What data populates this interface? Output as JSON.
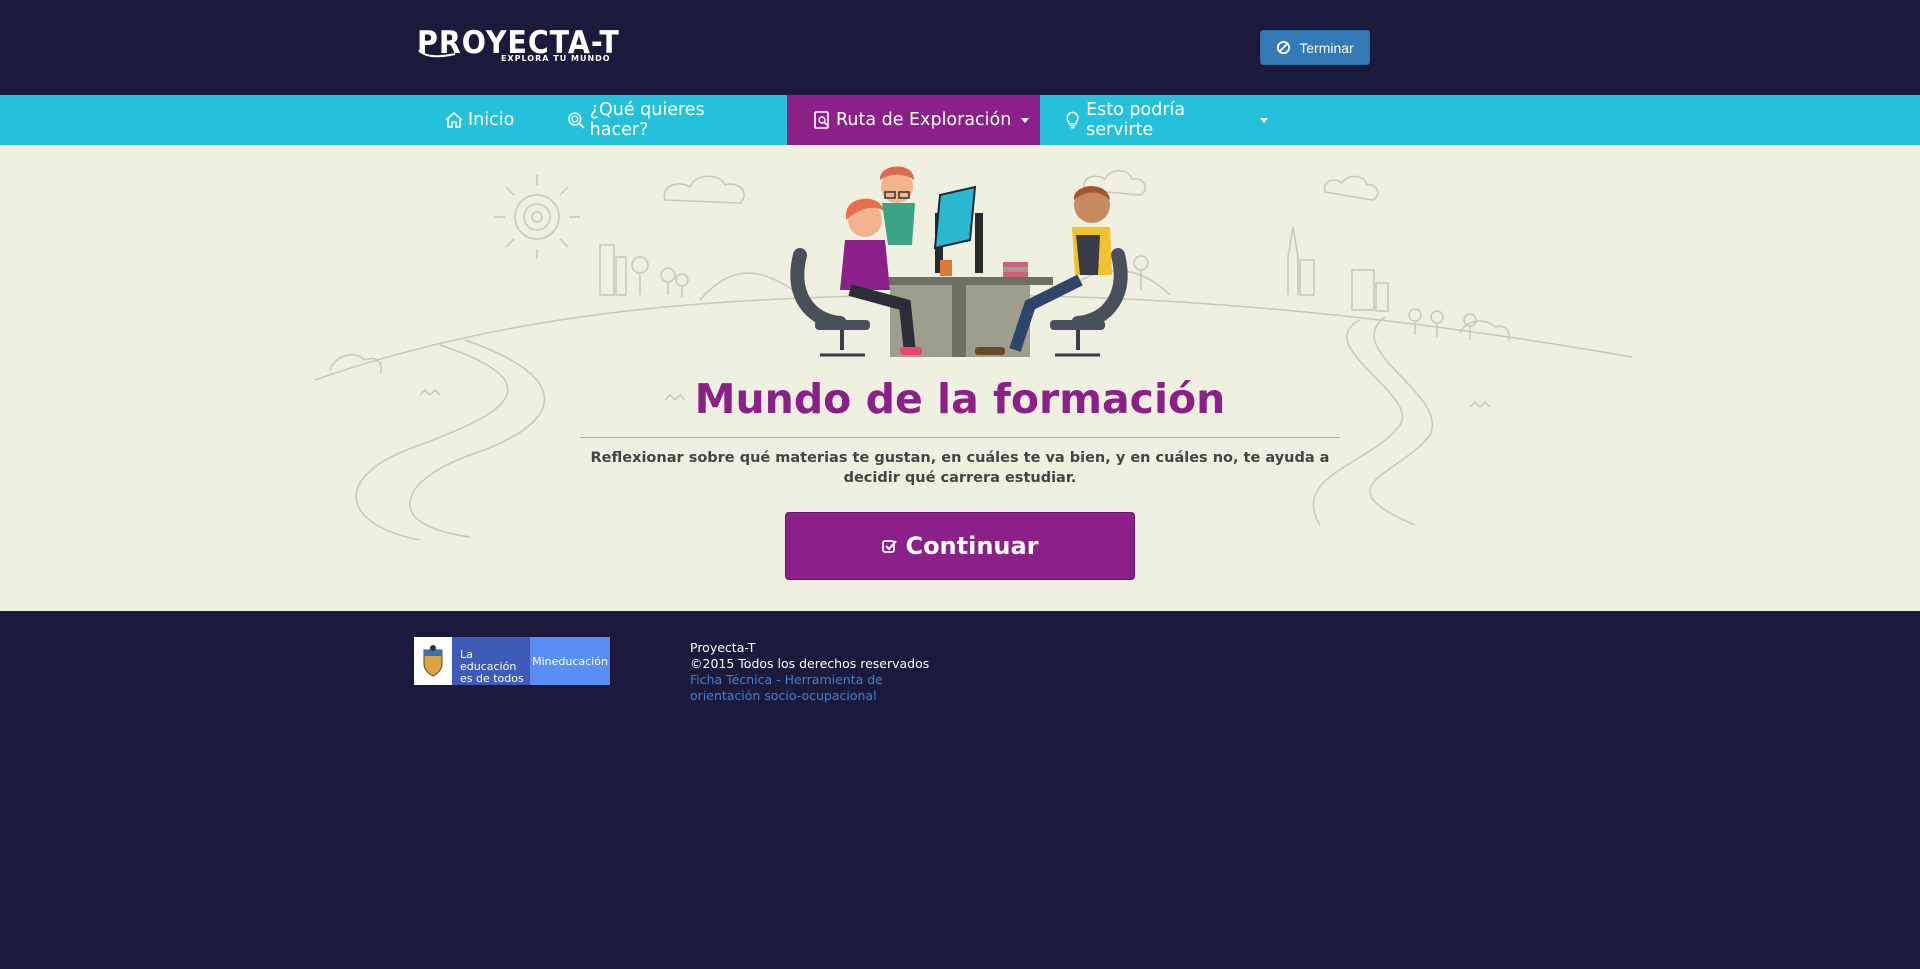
{
  "header": {
    "logo_text": "PROYECTA-T",
    "logo_tagline": "EXPLORA TU MUNDO",
    "terminar_label": "Terminar",
    "terminar_icon": "ban-icon"
  },
  "nav": {
    "items": [
      {
        "label": "Inicio",
        "icon": "home-icon"
      },
      {
        "label": "¿Qué quieres hacer?",
        "icon": "search-icon"
      },
      {
        "label": "Ruta de Exploración",
        "icon": "explore-icon",
        "active": true
      },
      {
        "label": "Esto podría servirte",
        "icon": "lightbulb-icon"
      }
    ],
    "active_color": "#8b2188",
    "bar_color": "#25c0d9"
  },
  "main": {
    "title": "Mundo de la formación",
    "description": "Reflexionar sobre qué materias te gustan, en cuáles te va bien, y en cuáles no, te ayuda a decidir qué carrera estudiar.",
    "continue_label": "Continuar",
    "continue_icon": "check-square-icon",
    "accent_color": "#8b2188"
  },
  "footer": {
    "logo_edu_text": "La educación es de todos",
    "logo_ministry_text": "Mineducación",
    "brand": "Proyecta-T",
    "copyright": "©2015 Todos los derechos reservados",
    "link_text": "Ficha Técnica - Herramienta de orientación socio-ocupacional"
  }
}
